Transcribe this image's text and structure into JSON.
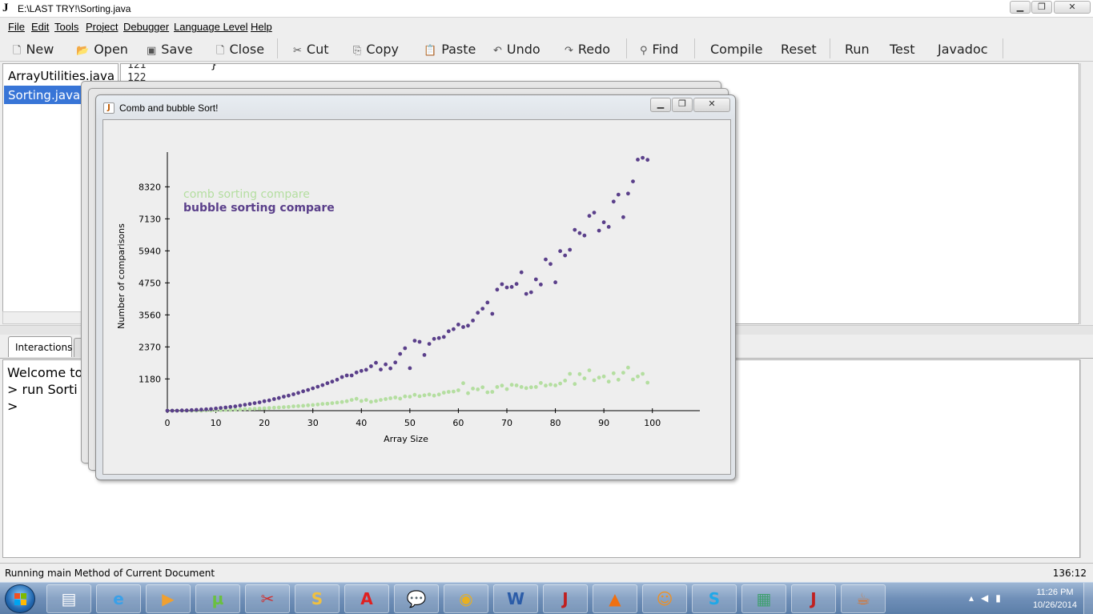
{
  "window": {
    "title": "E:\\LAST TRY!\\Sorting.java",
    "app_icon": "J"
  },
  "menu": [
    "File",
    "Edit",
    "Tools",
    "Project",
    "Debugger",
    "Language Level",
    "Help"
  ],
  "toolbar": {
    "new": "New",
    "open": "Open",
    "save": "Save",
    "close": "Close",
    "cut": "Cut",
    "copy": "Copy",
    "paste": "Paste",
    "undo": "Undo",
    "redo": "Redo",
    "find": "Find",
    "compile": "Compile",
    "reset": "Reset",
    "run": "Run",
    "test": "Test",
    "javadoc": "Javadoc"
  },
  "files": [
    "ArrayUtilities.java",
    "Sorting.java"
  ],
  "editor": {
    "line_numbers": [
      "121",
      "122"
    ],
    "code_line": "}"
  },
  "interactions": {
    "tab_label": "Interactions",
    "lines": [
      "Welcome to",
      "> run Sorti",
      ">"
    ]
  },
  "status": {
    "text": "Running main Method of Current Document",
    "position": "136:12"
  },
  "plot_window": {
    "title": "Comb and bubble Sort!",
    "icon": "J"
  },
  "chart_data": {
    "type": "scatter",
    "title": "",
    "xlabel": "Array Size",
    "ylabel": "Number of comparisons",
    "xlim": [
      0,
      105
    ],
    "ylim": [
      0,
      10800
    ],
    "xticks": [
      0,
      10,
      20,
      30,
      40,
      50,
      60,
      70,
      80,
      90,
      100
    ],
    "yticks": [
      1180,
      2370,
      3560,
      4750,
      5940,
      7130,
      8320
    ],
    "grid": false,
    "legend_placement": "top-left",
    "series": [
      {
        "name": "comb sorting compare",
        "color": "#b4dea0",
        "x": [
          0,
          1,
          2,
          3,
          4,
          5,
          6,
          7,
          8,
          9,
          10,
          11,
          12,
          13,
          14,
          15,
          16,
          17,
          18,
          19,
          20,
          21,
          22,
          23,
          24,
          25,
          26,
          27,
          28,
          29,
          30,
          31,
          32,
          33,
          34,
          35,
          36,
          37,
          38,
          39,
          40,
          41,
          42,
          43,
          44,
          45,
          46,
          47,
          48,
          49,
          50,
          51,
          52,
          53,
          54,
          55,
          56,
          57,
          58,
          59,
          60,
          61,
          62,
          63,
          64,
          65,
          66,
          67,
          68,
          69,
          70,
          71,
          72,
          73,
          74,
          75,
          76,
          77,
          78,
          79,
          80,
          81,
          82,
          83,
          84,
          85,
          86,
          87,
          88,
          89,
          90,
          91,
          92,
          93,
          94,
          95,
          96,
          97,
          98,
          99
        ],
        "y": [
          0,
          0,
          0,
          0,
          0,
          0,
          0,
          0,
          10,
          10,
          20,
          20,
          30,
          30,
          40,
          40,
          60,
          60,
          70,
          80,
          90,
          100,
          110,
          120,
          130,
          140,
          160,
          170,
          180,
          200,
          210,
          230,
          250,
          260,
          280,
          300,
          320,
          350,
          400,
          440,
          360,
          400,
          330,
          360,
          400,
          430,
          460,
          490,
          450,
          530,
          520,
          590,
          540,
          570,
          600,
          560,
          600,
          670,
          700,
          710,
          760,
          1020,
          650,
          820,
          790,
          870,
          680,
          700,
          880,
          930,
          800,
          960,
          940,
          880,
          840,
          870,
          880,
          1030,
          930,
          970,
          940,
          1010,
          1120,
          1370,
          990,
          1360,
          1200,
          1500,
          1130,
          1230,
          1270,
          1080,
          1390,
          1150,
          1410,
          1600,
          1160,
          1270,
          1370,
          1040
        ]
      },
      {
        "name": "bubble sorting compare",
        "color": "#5a3f8a",
        "x": [
          0,
          1,
          2,
          3,
          4,
          5,
          6,
          7,
          8,
          9,
          10,
          11,
          12,
          13,
          14,
          15,
          16,
          17,
          18,
          19,
          20,
          21,
          22,
          23,
          24,
          25,
          26,
          27,
          28,
          29,
          30,
          31,
          32,
          33,
          34,
          35,
          36,
          37,
          38,
          39,
          40,
          41,
          42,
          43,
          44,
          45,
          46,
          47,
          48,
          49,
          50,
          51,
          52,
          53,
          54,
          55,
          56,
          57,
          58,
          59,
          60,
          61,
          62,
          63,
          64,
          65,
          66,
          67,
          68,
          69,
          70,
          71,
          72,
          73,
          74,
          75,
          76,
          77,
          78,
          79,
          80,
          81,
          82,
          83,
          84,
          85,
          86,
          87,
          88,
          89,
          90,
          91,
          92,
          93,
          94,
          95,
          96,
          97,
          98,
          99
        ],
        "y": [
          0,
          0,
          0,
          10,
          10,
          20,
          30,
          40,
          50,
          60,
          80,
          100,
          120,
          140,
          160,
          190,
          220,
          250,
          280,
          310,
          350,
          380,
          430,
          470,
          520,
          560,
          610,
          660,
          720,
          770,
          830,
          890,
          950,
          1020,
          1080,
          1150,
          1250,
          1310,
          1310,
          1420,
          1480,
          1520,
          1650,
          1780,
          1530,
          1720,
          1570,
          1790,
          2110,
          2320,
          1580,
          2600,
          2560,
          2070,
          2480,
          2670,
          2700,
          2740,
          2950,
          3030,
          3200,
          3110,
          3160,
          3350,
          3640,
          3790,
          4020,
          3600,
          4500,
          4700,
          4580,
          4600,
          4710,
          5140,
          4340,
          4400,
          4880,
          4690,
          5620,
          5450,
          4770,
          5930,
          5770,
          5980,
          6720,
          6600,
          6510,
          7240,
          7360,
          6690,
          7000,
          6830,
          7770,
          8030,
          7190,
          8070,
          8520,
          9330,
          9400,
          9320
        ]
      }
    ]
  }
}
